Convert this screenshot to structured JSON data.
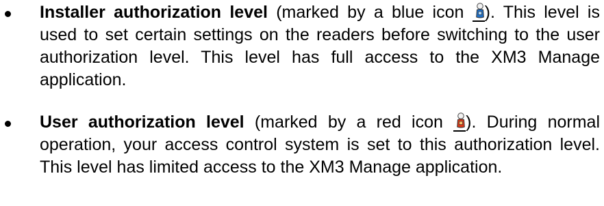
{
  "bullets": [
    {
      "term": "Installer authorization level",
      "before_icon": " (marked by a blue icon",
      "icon": "person-icon-blue",
      "icon_color": "#1f6fc7",
      "after_icon": "). This level is used to set certain settings on the readers before switching to the user authorization level. This level has full access to the XM3 Manage application."
    },
    {
      "term": "User authorization level",
      "before_icon": " (marked by a red icon",
      "icon": "person-icon-red",
      "icon_color": "#d83a1a",
      "after_icon": "). During normal operation, your access control system is set to this authorization level. This level has limited access to the XM3 Manage application."
    }
  ]
}
